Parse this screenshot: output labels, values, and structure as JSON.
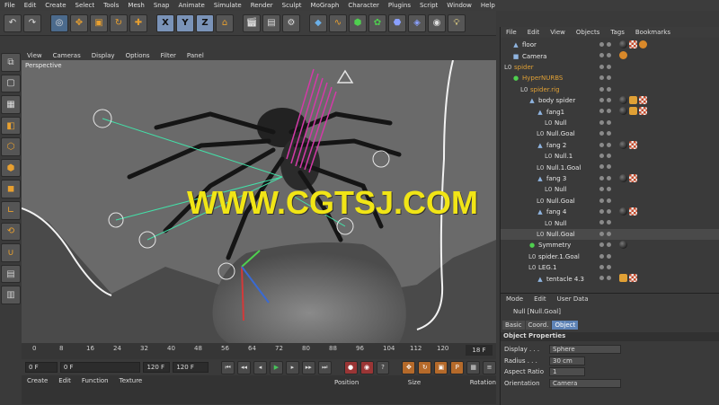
{
  "menubar": [
    "File",
    "Edit",
    "Create",
    "Select",
    "Tools",
    "Mesh",
    "Snap",
    "Animate",
    "Simulate",
    "Render",
    "Sculpt",
    "MoGraph",
    "Character",
    "Plugins",
    "Script",
    "Window",
    "Help"
  ],
  "viewport": {
    "menu": [
      "View",
      "Cameras",
      "Display",
      "Options",
      "Filter",
      "Panel"
    ],
    "label": "Perspective",
    "watermark": "WWW.CGTSJ.COM"
  },
  "timeline": {
    "ticks": [
      "0",
      "8",
      "16",
      "24",
      "32",
      "40",
      "48",
      "56",
      "64",
      "72",
      "80",
      "88",
      "96",
      "104",
      "112",
      "120"
    ],
    "current_frame": "18 F"
  },
  "transport": {
    "start": "0 F",
    "start2": "0 F",
    "end2": "120 F",
    "end": "120 F"
  },
  "bottom_menu": [
    "Create",
    "Edit",
    "Function",
    "Texture"
  ],
  "coord_headers": [
    "Position",
    "Size",
    "Rotation"
  ],
  "object_manager": {
    "menu": [
      "File",
      "Edit",
      "View",
      "Objects",
      "Tags",
      "Bookmarks"
    ],
    "rows": [
      {
        "name": "floor",
        "indent": 1,
        "color": "white",
        "icon": "▲"
      },
      {
        "name": "Camera",
        "indent": 1,
        "color": "white",
        "icon": "■"
      },
      {
        "name": "spider",
        "indent": 0,
        "color": "orange",
        "icon": "L0"
      },
      {
        "name": "HyperNURBS",
        "indent": 1,
        "color": "orange",
        "icon": "●"
      },
      {
        "name": "spider.rig",
        "indent": 2,
        "color": "orange",
        "icon": "L0"
      },
      {
        "name": "body spider",
        "indent": 3,
        "color": "white",
        "icon": "▲"
      },
      {
        "name": "fang1",
        "indent": 4,
        "color": "white",
        "icon": "▲"
      },
      {
        "name": "Null",
        "indent": 5,
        "color": "white",
        "icon": "L0"
      },
      {
        "name": "Null.Goal",
        "indent": 4,
        "color": "white",
        "icon": "L0"
      },
      {
        "name": "fang 2",
        "indent": 4,
        "color": "white",
        "icon": "▲"
      },
      {
        "name": "Null.1",
        "indent": 5,
        "color": "white",
        "icon": "L0"
      },
      {
        "name": "Null.1.Goal",
        "indent": 4,
        "color": "white",
        "icon": "L0"
      },
      {
        "name": "fang 3",
        "indent": 4,
        "color": "white",
        "icon": "▲"
      },
      {
        "name": "Null",
        "indent": 5,
        "color": "white",
        "icon": "L0"
      },
      {
        "name": "Null.Goal",
        "indent": 4,
        "color": "white",
        "icon": "L0"
      },
      {
        "name": "fang 4",
        "indent": 4,
        "color": "white",
        "icon": "▲"
      },
      {
        "name": "Null",
        "indent": 5,
        "color": "white",
        "icon": "L0"
      },
      {
        "name": "Null.Goal",
        "indent": 4,
        "color": "white",
        "icon": "L0"
      },
      {
        "name": "Symmetry",
        "indent": 3,
        "color": "white",
        "icon": "●"
      },
      {
        "name": "spider.1.Goal",
        "indent": 3,
        "color": "white",
        "icon": "L0"
      },
      {
        "name": "LEG.1",
        "indent": 3,
        "color": "white",
        "icon": "L0"
      },
      {
        "name": "tentacle 4.3",
        "indent": 4,
        "color": "white",
        "icon": "▲"
      }
    ]
  },
  "attributes": {
    "menu": [
      "Mode",
      "Edit",
      "User Data"
    ],
    "title": "Null [Null.Goal]",
    "tabs": [
      "Basic",
      "Coord.",
      "Object"
    ],
    "active_tab": "Object",
    "section": "Object Properties",
    "props": [
      {
        "label": "Display . . .",
        "value": "Sphere"
      },
      {
        "label": "Radius . . .",
        "value": "30 cm"
      },
      {
        "label": "Aspect Ratio",
        "value": "1"
      },
      {
        "label": "Orientation",
        "value": "Camera"
      }
    ]
  }
}
